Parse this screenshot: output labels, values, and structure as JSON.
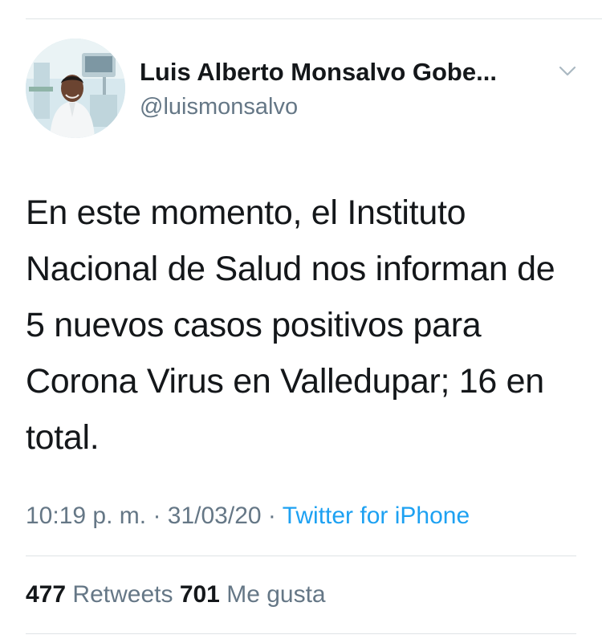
{
  "author": {
    "display_name": "Luis Alberto Monsalvo Gobe...",
    "handle": "@luismonsalvo"
  },
  "tweet": {
    "text": "En este momento, el Instituto Nacional de Salud nos informan de 5 nuevos casos positivos para Corona Virus en Valledupar; 16 en total.",
    "time": "10:19 p. m.",
    "separator": "·",
    "date": "31/03/20",
    "source": "Twitter for iPhone"
  },
  "stats": {
    "retweets_count": "477",
    "retweets_label": "Retweets",
    "likes_count": "701",
    "likes_label": "Me gusta"
  },
  "icons": {
    "menu": "chevron-down-icon"
  },
  "colors": {
    "text_primary": "#14171a",
    "text_secondary": "#657786",
    "link": "#1da1f2",
    "divider": "#dfe3e6"
  }
}
